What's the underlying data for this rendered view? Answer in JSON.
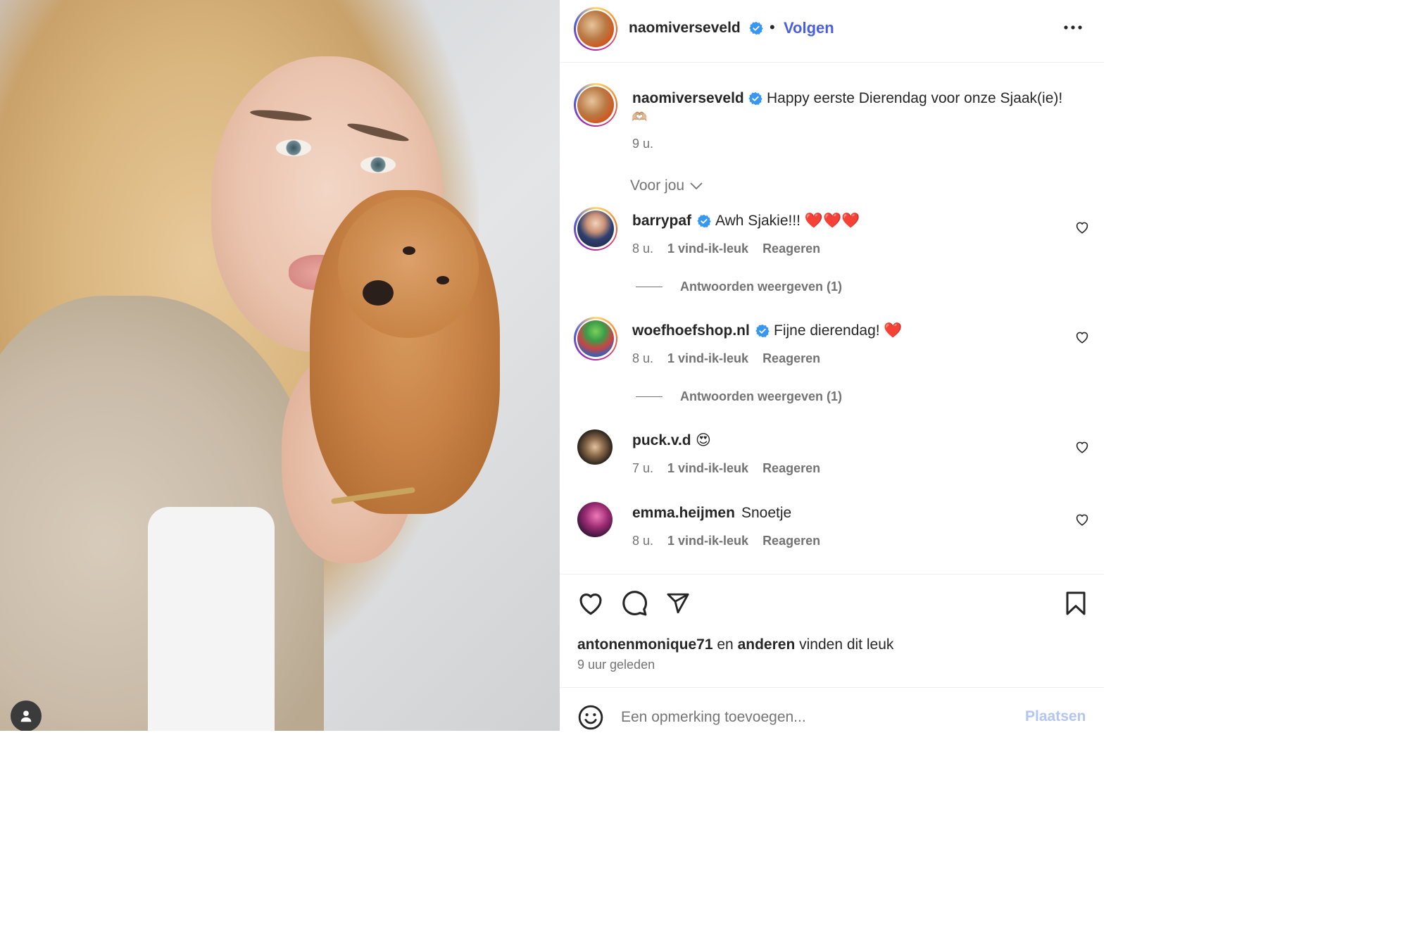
{
  "post_author": {
    "username": "naomiverseveld",
    "follow_label": "Volgen"
  },
  "caption": {
    "username": "naomiverseveld",
    "text": "Happy eerste Dierendag voor onze Sjaak(ie)!",
    "emoji": "🫶🏼",
    "time": "9 u."
  },
  "sort_label": "Voor jou",
  "comments": [
    {
      "username": "barrypaf",
      "verified": true,
      "text": "Awh Sjakie!!! ❤️❤️❤️",
      "time": "8 u.",
      "likes": "1 vind-ik-leuk",
      "reply": "Reageren",
      "view_replies": "Antwoorden weergeven (1)"
    },
    {
      "username": "woefhoefshop.nl",
      "verified": true,
      "text": "Fijne dierendag! ❤️",
      "time": "8 u.",
      "likes": "1 vind-ik-leuk",
      "reply": "Reageren",
      "view_replies": "Antwoorden weergeven (1)"
    },
    {
      "username": "puck.v.d",
      "verified": false,
      "text": "😍",
      "time": "7 u.",
      "likes": "1 vind-ik-leuk",
      "reply": "Reageren"
    },
    {
      "username": "emma.heijmen",
      "verified": false,
      "text": "Snoetje",
      "time": "8 u.",
      "likes": "1 vind-ik-leuk",
      "reply": "Reageren"
    }
  ],
  "likes_line": {
    "user": "antonenmonique71",
    "mid": "en",
    "others": "anderen",
    "tail": "vinden dit leuk"
  },
  "post_time": "9 uur geleden",
  "add_comment": {
    "placeholder": "Een opmerking toevoegen...",
    "post_label": "Plaatsen"
  },
  "colors": {
    "accent": "#4a5ee0",
    "verified": "#3897f0",
    "muted": "#737373",
    "post_disabled": "#b2c6f5"
  },
  "icons": [
    "more-icon",
    "verified-icon",
    "chevron-down-icon",
    "heart-icon",
    "comment-icon",
    "share-icon",
    "bookmark-icon",
    "emoji-icon",
    "user-icon"
  ]
}
